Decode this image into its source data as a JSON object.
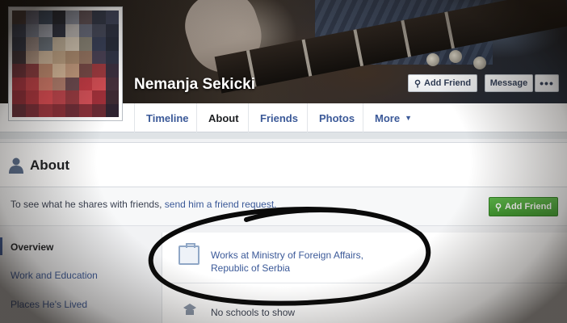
{
  "profile": {
    "name": "Nemanja Sekicki",
    "buttons": {
      "add_friend": "Add Friend",
      "message": "Message",
      "more": "•••"
    },
    "avatar_pixels": [
      "#4a3a3a",
      "#6b6d84",
      "#3a4b63",
      "#20242f",
      "#8a8f9e",
      "#5d4e54",
      "#2e3445",
      "#3b4158",
      "#384057",
      "#7e8599",
      "#a9aebc",
      "#2b3041",
      "#c5c1bf",
      "#6a6f82",
      "#44495c",
      "#2a2f40",
      "#2f3547",
      "#a08f8a",
      "#6f7a86",
      "#c8b8a0",
      "#e0d3bf",
      "#8f8a7c",
      "#37405a",
      "#262b3a",
      "#3c2f35",
      "#b79b88",
      "#d9bfa3",
      "#c9ab8b",
      "#b69375",
      "#9d7a66",
      "#4a4258",
      "#303548",
      "#6b2d35",
      "#8e3a3e",
      "#c78e72",
      "#e3c3a3",
      "#cfa385",
      "#7a4a48",
      "#a23a40",
      "#3a2f3f",
      "#a3303b",
      "#c43f46",
      "#d97c6b",
      "#b98271",
      "#6e4a50",
      "#c63a44",
      "#d84e55",
      "#45303c",
      "#8a2a34",
      "#b0343d",
      "#e04b52",
      "#c4454d",
      "#9a3a41",
      "#d65058",
      "#a3303a",
      "#3d2a33",
      "#5e2a33",
      "#7a2c36",
      "#a0353e",
      "#8d2f38",
      "#6f2d37",
      "#8a3039",
      "#6a2a33",
      "#2e2330"
    ]
  },
  "tabs": [
    {
      "label": "Timeline"
    },
    {
      "label": "About"
    },
    {
      "label": "Friends"
    },
    {
      "label": "Photos"
    },
    {
      "label": "More"
    }
  ],
  "about": {
    "title": "About",
    "info_prefix": "To see what he shares with friends, ",
    "info_link": "send him a friend request.",
    "add_friend_label": "Add Friend"
  },
  "left_nav": [
    {
      "label": "Overview"
    },
    {
      "label": "Work and Education"
    },
    {
      "label": "Places He's Lived"
    }
  ],
  "content": {
    "work": "Works at Ministry of Foreign Affairs, Republic of Serbia",
    "schools": "No schools to show"
  },
  "colors": {
    "link": "#3b5998",
    "green_button": "#4ea93c"
  }
}
